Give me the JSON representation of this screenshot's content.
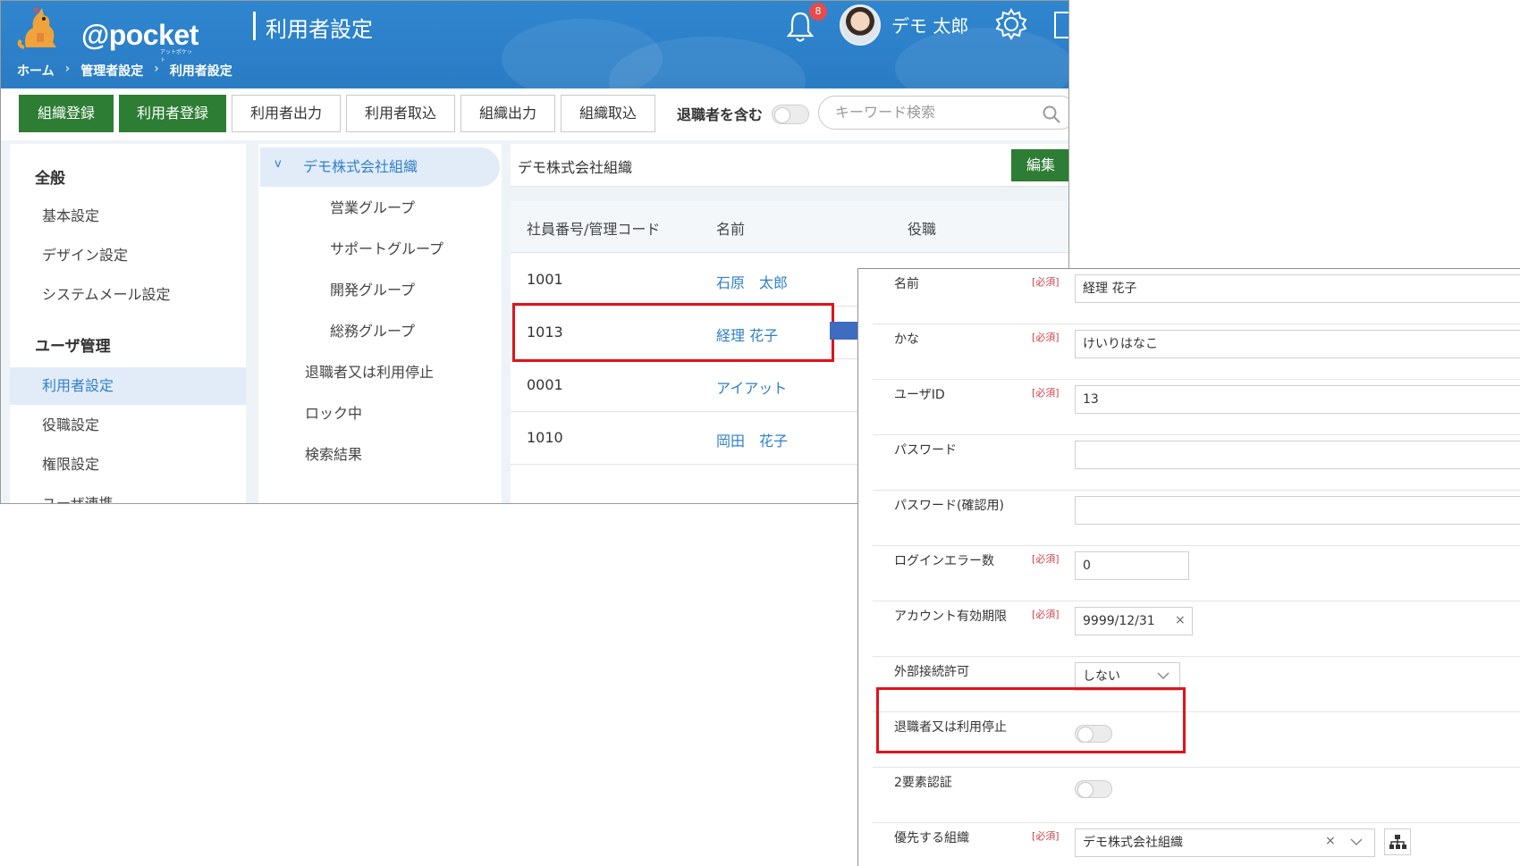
{
  "header": {
    "logo_text": "@pocket",
    "logo_sub": "アットポケット",
    "page_title": "利用者設定",
    "breadcrumb": [
      "ホーム",
      "管理者設定",
      "利用者設定"
    ],
    "breadcrumb_sep": "›",
    "notification_count": "8",
    "user_name": "デモ 太郎"
  },
  "toolbar": {
    "buttons": [
      "組織登録",
      "利用者登録",
      "利用者出力",
      "利用者取込",
      "組織出力",
      "組織取込"
    ],
    "include_retired_label": "退職者を含む",
    "search_placeholder": "キーワード検索"
  },
  "sidebar": {
    "section_general": "全般",
    "general_items": [
      "基本設定",
      "デザイン設定",
      "システムメール設定"
    ],
    "section_user": "ユーザ管理",
    "user_items": [
      "利用者設定",
      "役職設定",
      "権限設定",
      "ユーザ連携"
    ]
  },
  "tree": {
    "root": "デモ株式会社組織",
    "root_chevron": "v",
    "groups": [
      "営業グループ",
      "サポートグループ",
      "開発グループ",
      "総務グループ"
    ],
    "special": [
      "退職者又は利用停止",
      "ロック中",
      "検索結果"
    ]
  },
  "content": {
    "org_name": "デモ株式会社組織",
    "edit_label": "編集",
    "columns": [
      "社員番号/管理コード",
      "名前",
      "役職"
    ],
    "rows": [
      {
        "code": "1001",
        "name": "石原　太郎"
      },
      {
        "code": "1013",
        "name": "経理 花子"
      },
      {
        "code": "0001",
        "name": "アイアット"
      },
      {
        "code": "1010",
        "name": "岡田　花子"
      }
    ]
  },
  "form": {
    "required_tag": "[必須]",
    "clear_symbol": "×",
    "fields": {
      "name": {
        "label": "名前",
        "value": "経理  花子"
      },
      "kana": {
        "label": "かな",
        "value": "けいりはなこ"
      },
      "user_id": {
        "label": "ユーザID",
        "value": "13"
      },
      "password": {
        "label": "パスワード",
        "value": ""
      },
      "password_confirm": {
        "label": "パスワード(確認用)",
        "value": ""
      },
      "login_errors": {
        "label": "ログインエラー数",
        "value": "0"
      },
      "expiry": {
        "label": "アカウント有効期限",
        "value": "9999/12/31"
      },
      "external": {
        "label": "外部接続許可",
        "value": "しない"
      },
      "retired": {
        "label": "退職者又は利用停止"
      },
      "two_factor": {
        "label": "2要素認証"
      },
      "priority_org": {
        "label": "優先する組織",
        "value": "デモ株式会社組織"
      }
    }
  },
  "colors": {
    "header_blue": "#2a7cc4",
    "green": "#2d7d34",
    "highlight_red": "#e0131b",
    "link_blue": "#2f80c8",
    "arrow_blue": "#3d6cc0"
  }
}
